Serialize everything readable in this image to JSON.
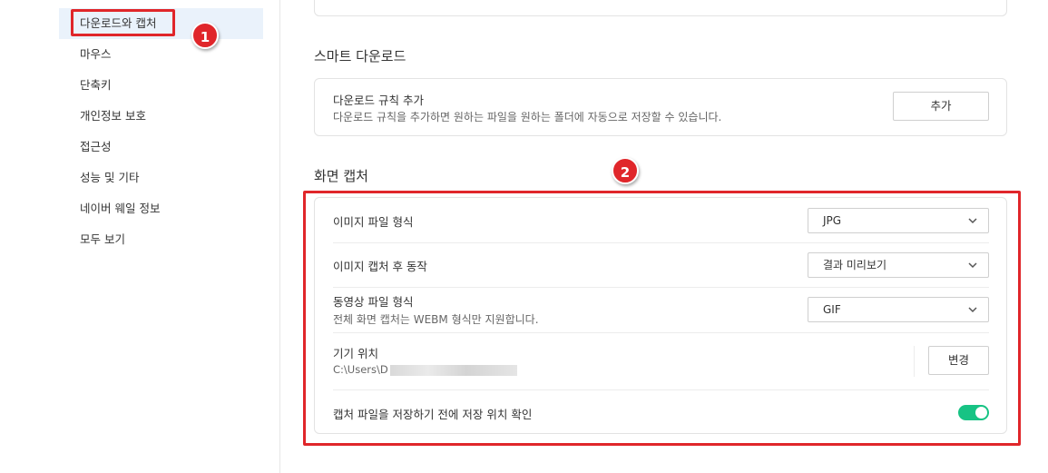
{
  "sidebar": {
    "items": [
      {
        "label": "다운로드와 캡처",
        "active": true
      },
      {
        "label": "마우스"
      },
      {
        "label": "단축키"
      },
      {
        "label": "개인정보 보호"
      },
      {
        "label": "접근성"
      },
      {
        "label": "성능 및 기타"
      },
      {
        "label": "네이버 웨일 정보"
      },
      {
        "label": "모두 보기"
      }
    ]
  },
  "annotations": {
    "badge1": "1",
    "badge2": "2",
    "highlight_color": "#e0262a"
  },
  "smart_download": {
    "title": "스마트 다운로드",
    "rule_title": "다운로드 규칙 추가",
    "rule_desc": "다운로드 규칙을 추가하면 원하는 파일을 원하는 폴더에 자동으로 저장할 수 있습니다.",
    "add_button": "추가"
  },
  "screen_capture": {
    "title": "화면 캡처",
    "image_format": {
      "label": "이미지 파일 형식",
      "value": "JPG"
    },
    "after_capture": {
      "label": "이미지 캡처 후 동작",
      "value": "결과 미리보기"
    },
    "video_format": {
      "label": "동영상 파일 형식",
      "desc": "전체 화면 캡처는 WEBM 형식만 지원합니다.",
      "value": "GIF"
    },
    "location": {
      "label": "기기 위치",
      "path": "C:\\Users\\D",
      "change_button": "변경"
    },
    "confirm_location": {
      "label": "캡처 파일을 저장하기 전에 저장 위치 확인",
      "enabled": true
    }
  },
  "colors": {
    "toggle_on": "#17c384",
    "active_bg": "#eaf2fb"
  }
}
